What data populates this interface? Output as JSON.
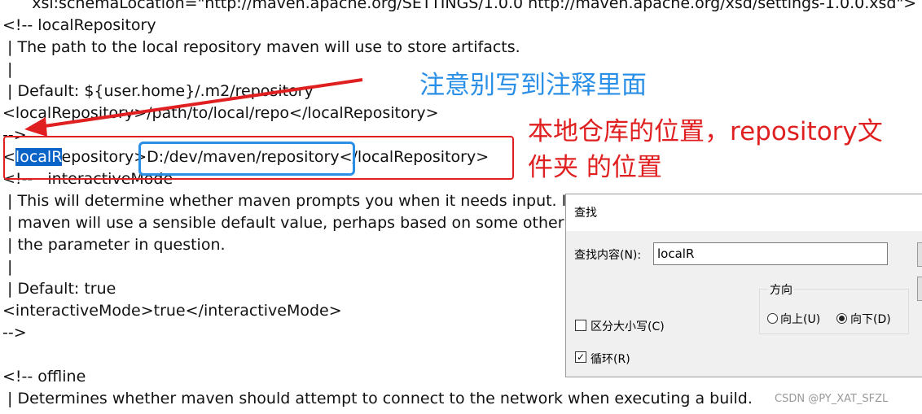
{
  "editor": {
    "lines": [
      "      xsi:schemaLocation=\"http://maven.apache.org/SETTINGS/1.0.0 http://maven.apache.org/xsd/settings-1.0.0.xsd\">",
      "<!-- localRepository",
      " | The path to the local repository maven will use to store artifacts.",
      " |",
      " | Default: ${user.home}/.m2/repository",
      "<localRepository>/path/to/local/repo</localRepository>",
      "-->",
      "",
      "<!--   interactiveMode",
      " | This will determine whether maven prompts you when it needs input. If set to false,",
      " | maven will use a sensible default value, perhaps based on some other setting, for",
      " | the parameter in question.",
      " |",
      " | Default: true",
      "<interactiveMode>true</interactiveMode>",
      "-->",
      "",
      "<!-- offline",
      " | Determines whether maven should attempt to connect to the network when executing a build."
    ],
    "target_line": {
      "prefix": "<",
      "highlight": "localR",
      "rest": "epository>",
      "path": "D:/dev/maven/repository",
      "close": "</localRepository>"
    }
  },
  "annotations": {
    "blue_note": "注意别写到注释里面",
    "red_note_line1": "本地仓库的位置，repository文",
    "red_note_line2": "件夹 的位置",
    "colors": {
      "red": "#e02020",
      "blue": "#2a8fe6",
      "selection": "#0a64c8"
    }
  },
  "find_dialog": {
    "title": "查找",
    "find_label": "查找内容(N):",
    "find_value": "localR",
    "direction_label": "方向",
    "up_label": "向上(U)",
    "down_label": "向下(D)",
    "direction_selected": "down",
    "match_case_label": "区分大小写(C)",
    "match_case_checked": false,
    "wrap_label": "循环(R)",
    "wrap_checked": true
  },
  "watermark": "CSDN @PY_XAT_SFZL"
}
